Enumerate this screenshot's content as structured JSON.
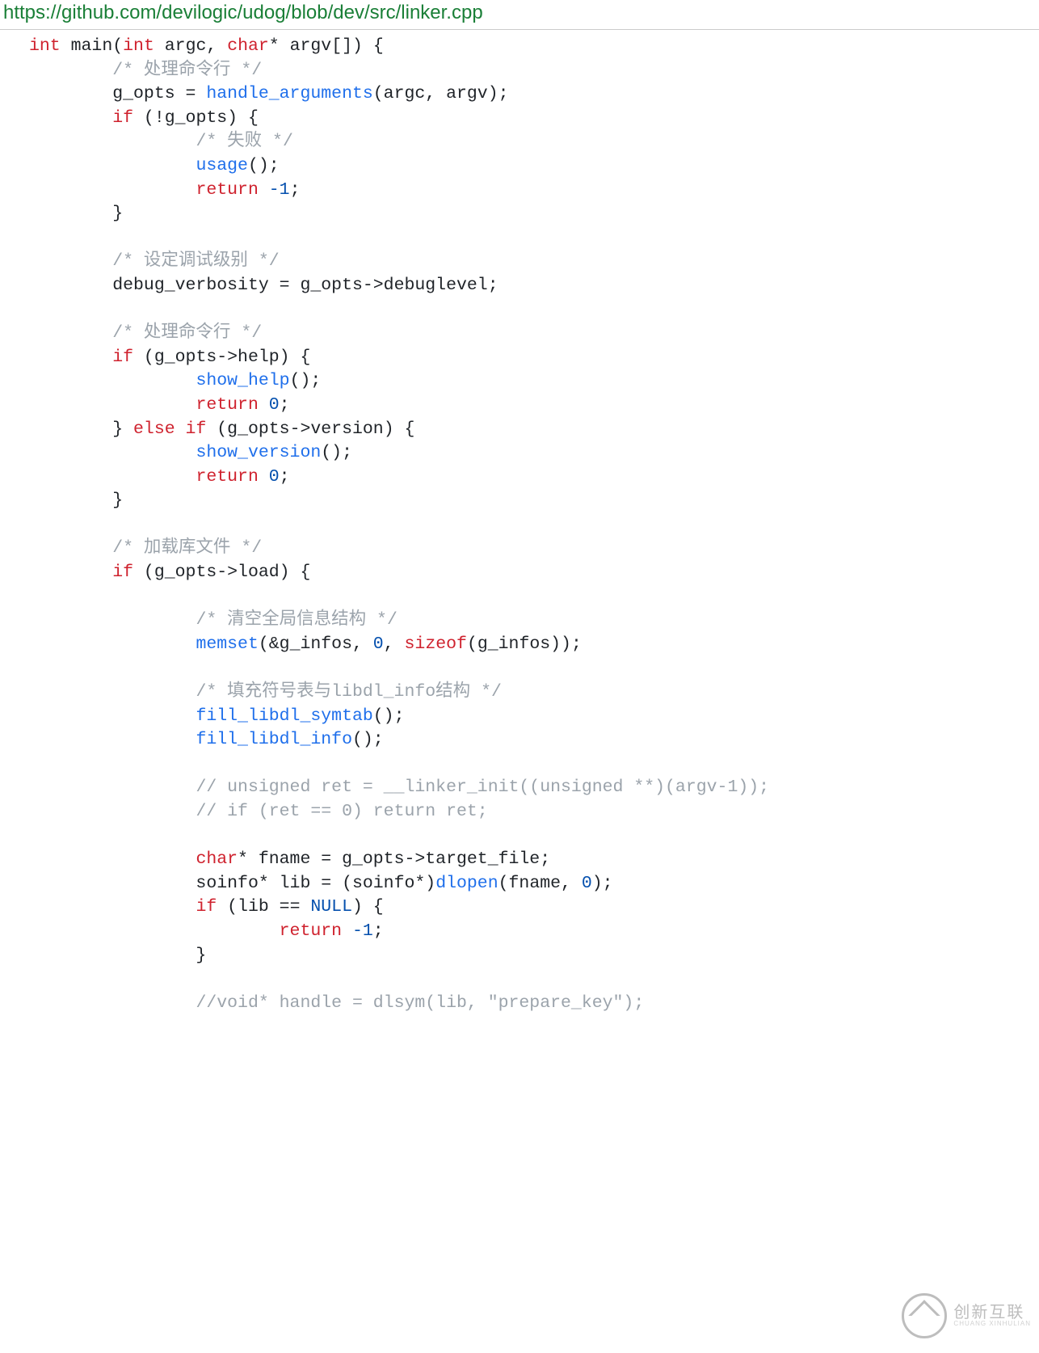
{
  "url": "https://github.com/devilogic/udog/blob/dev/src/linker.cpp",
  "code_lines": [
    [
      [
        "kw",
        "int"
      ],
      [
        "op",
        " main("
      ],
      [
        "kw",
        "int"
      ],
      [
        "op",
        " argc, "
      ],
      [
        "kw",
        "char"
      ],
      [
        "op",
        "* argv[]) {"
      ]
    ],
    [
      [
        "op",
        "        "
      ],
      [
        "c",
        "/* 处理命令行 */"
      ]
    ],
    [
      [
        "op",
        "        g_opts = "
      ],
      [
        "fn",
        "handle_arguments"
      ],
      [
        "op",
        "(argc, argv);"
      ]
    ],
    [
      [
        "op",
        "        "
      ],
      [
        "kw",
        "if"
      ],
      [
        "op",
        " (!g_opts) {"
      ]
    ],
    [
      [
        "op",
        "                "
      ],
      [
        "c",
        "/* 失败 */"
      ]
    ],
    [
      [
        "op",
        "                "
      ],
      [
        "fn",
        "usage"
      ],
      [
        "op",
        "();"
      ]
    ],
    [
      [
        "op",
        "                "
      ],
      [
        "kw",
        "return"
      ],
      [
        "op",
        " "
      ],
      [
        "num",
        "-1"
      ],
      [
        "op",
        ";"
      ]
    ],
    [
      [
        "op",
        "        }"
      ]
    ],
    [
      [
        "op",
        ""
      ]
    ],
    [
      [
        "op",
        "        "
      ],
      [
        "c",
        "/* 设定调试级别 */"
      ]
    ],
    [
      [
        "op",
        "        debug_verbosity = g_opts->debuglevel;"
      ]
    ],
    [
      [
        "op",
        ""
      ]
    ],
    [
      [
        "op",
        "        "
      ],
      [
        "c",
        "/* 处理命令行 */"
      ]
    ],
    [
      [
        "op",
        "        "
      ],
      [
        "kw",
        "if"
      ],
      [
        "op",
        " (g_opts->help) {"
      ]
    ],
    [
      [
        "op",
        "                "
      ],
      [
        "fn",
        "show_help"
      ],
      [
        "op",
        "();"
      ]
    ],
    [
      [
        "op",
        "                "
      ],
      [
        "kw",
        "return"
      ],
      [
        "op",
        " "
      ],
      [
        "num",
        "0"
      ],
      [
        "op",
        ";"
      ]
    ],
    [
      [
        "op",
        "        } "
      ],
      [
        "kw",
        "else"
      ],
      [
        "op",
        " "
      ],
      [
        "kw",
        "if"
      ],
      [
        "op",
        " (g_opts->version) {"
      ]
    ],
    [
      [
        "op",
        "                "
      ],
      [
        "fn",
        "show_version"
      ],
      [
        "op",
        "();"
      ]
    ],
    [
      [
        "op",
        "                "
      ],
      [
        "kw",
        "return"
      ],
      [
        "op",
        " "
      ],
      [
        "num",
        "0"
      ],
      [
        "op",
        ";"
      ]
    ],
    [
      [
        "op",
        "        }"
      ]
    ],
    [
      [
        "op",
        ""
      ]
    ],
    [
      [
        "op",
        "        "
      ],
      [
        "c",
        "/* 加载库文件 */"
      ]
    ],
    [
      [
        "op",
        "        "
      ],
      [
        "kw",
        "if"
      ],
      [
        "op",
        " (g_opts->load) {"
      ]
    ],
    [
      [
        "op",
        ""
      ]
    ],
    [
      [
        "op",
        "                "
      ],
      [
        "c",
        "/* 清空全局信息结构 */"
      ]
    ],
    [
      [
        "op",
        "                "
      ],
      [
        "fn",
        "memset"
      ],
      [
        "op",
        "(&g_infos, "
      ],
      [
        "num",
        "0"
      ],
      [
        "op",
        ", "
      ],
      [
        "kw",
        "sizeof"
      ],
      [
        "op",
        "(g_infos));"
      ]
    ],
    [
      [
        "op",
        ""
      ]
    ],
    [
      [
        "op",
        "                "
      ],
      [
        "c",
        "/* 填充符号表与libdl_info结构 */"
      ]
    ],
    [
      [
        "op",
        "                "
      ],
      [
        "fn",
        "fill_libdl_symtab"
      ],
      [
        "op",
        "();"
      ]
    ],
    [
      [
        "op",
        "                "
      ],
      [
        "fn",
        "fill_libdl_info"
      ],
      [
        "op",
        "();"
      ]
    ],
    [
      [
        "op",
        ""
      ]
    ],
    [
      [
        "op",
        "                "
      ],
      [
        "c",
        "// unsigned ret = __linker_init((unsigned **)(argv-1));"
      ]
    ],
    [
      [
        "op",
        "                "
      ],
      [
        "c",
        "// if (ret == 0) return ret;"
      ]
    ],
    [
      [
        "op",
        ""
      ]
    ],
    [
      [
        "op",
        "                "
      ],
      [
        "kw",
        "char"
      ],
      [
        "op",
        "* fname = g_opts->target_file;"
      ]
    ],
    [
      [
        "op",
        "                soinfo* lib = (soinfo*)"
      ],
      [
        "fn",
        "dlopen"
      ],
      [
        "op",
        "(fname, "
      ],
      [
        "num",
        "0"
      ],
      [
        "op",
        ");"
      ]
    ],
    [
      [
        "op",
        "                "
      ],
      [
        "kw",
        "if"
      ],
      [
        "op",
        " (lib == "
      ],
      [
        "num",
        "NULL"
      ],
      [
        "op",
        ") {"
      ]
    ],
    [
      [
        "op",
        "                        "
      ],
      [
        "kw",
        "return"
      ],
      [
        "op",
        " "
      ],
      [
        "num",
        "-1"
      ],
      [
        "op",
        ";"
      ]
    ],
    [
      [
        "op",
        "                }"
      ]
    ],
    [
      [
        "op",
        ""
      ]
    ],
    [
      [
        "op",
        "                "
      ],
      [
        "c",
        "//void* handle = dlsym(lib, \"prepare_key\");"
      ]
    ]
  ],
  "watermark": {
    "cn": "创新互联",
    "en": "CHUANG XINHULIAN"
  }
}
